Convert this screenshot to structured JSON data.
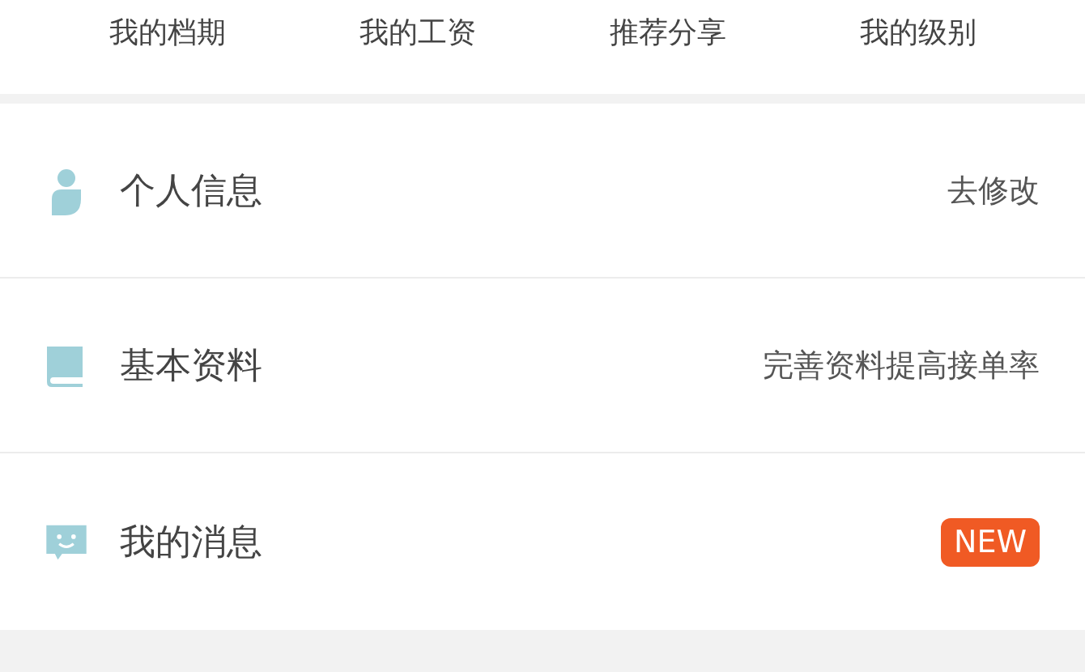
{
  "top_menu": [
    "我的档期",
    "我的工资",
    "推荐分享",
    "我的级别"
  ],
  "rows": [
    {
      "label": "个人信息",
      "right": {
        "kind": "text",
        "text": "去修改"
      }
    },
    {
      "label": "基本资料",
      "right": {
        "kind": "text",
        "text": "完善资料提高接单率"
      }
    },
    {
      "label": "我的消息",
      "right": {
        "kind": "badge",
        "text": "NEW"
      }
    }
  ]
}
